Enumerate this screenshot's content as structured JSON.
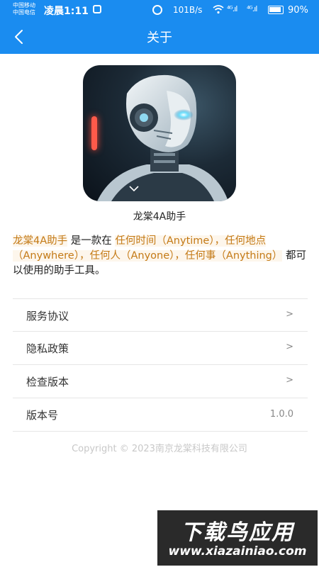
{
  "status_bar": {
    "carrier_1": "中国移动",
    "carrier_2": "中国电信",
    "time": "凌晨1:11",
    "network_speed": "101B/s",
    "signal_1": "⁴ᴳ.ıl",
    "signal_2": "⁴ᴳ.ıl",
    "battery": "90%",
    "icons": [
      "shield-icon",
      "alarm-icon",
      "wifi-icon",
      "signal-icon",
      "battery-icon"
    ]
  },
  "nav": {
    "title": "关于",
    "back_icon": "chevron-left-icon"
  },
  "app": {
    "name": "龙棠4A助手",
    "icon": "robot-head-image"
  },
  "description": {
    "segments": [
      {
        "text": "龙棠4A助手",
        "highlight": true
      },
      {
        "text": " 是一款在 ",
        "highlight": false
      },
      {
        "text": "任何时间（Anytime），任何地点（Anywhere），任何人（Anyone），任何事（Anything）",
        "highlight": true
      },
      {
        "text": " 都可以使用的助手工具。",
        "highlight": false
      }
    ]
  },
  "menu": {
    "items": [
      {
        "label": "服务协议",
        "trailing": ">"
      },
      {
        "label": "隐私政策",
        "trailing": ">"
      },
      {
        "label": "检查版本",
        "trailing": ">"
      },
      {
        "label": "版本号",
        "trailing": "1.0.0"
      }
    ]
  },
  "footer": {
    "copyright": "Copyright © 2023南京龙棠科技有限公司"
  },
  "watermark": {
    "title": "下载鸟应用",
    "url": "www.xiazainiao.com"
  },
  "colors": {
    "primary": "#1a8cf0",
    "highlight_text": "#c47a16",
    "highlight_bg": "#fdf6ec"
  }
}
